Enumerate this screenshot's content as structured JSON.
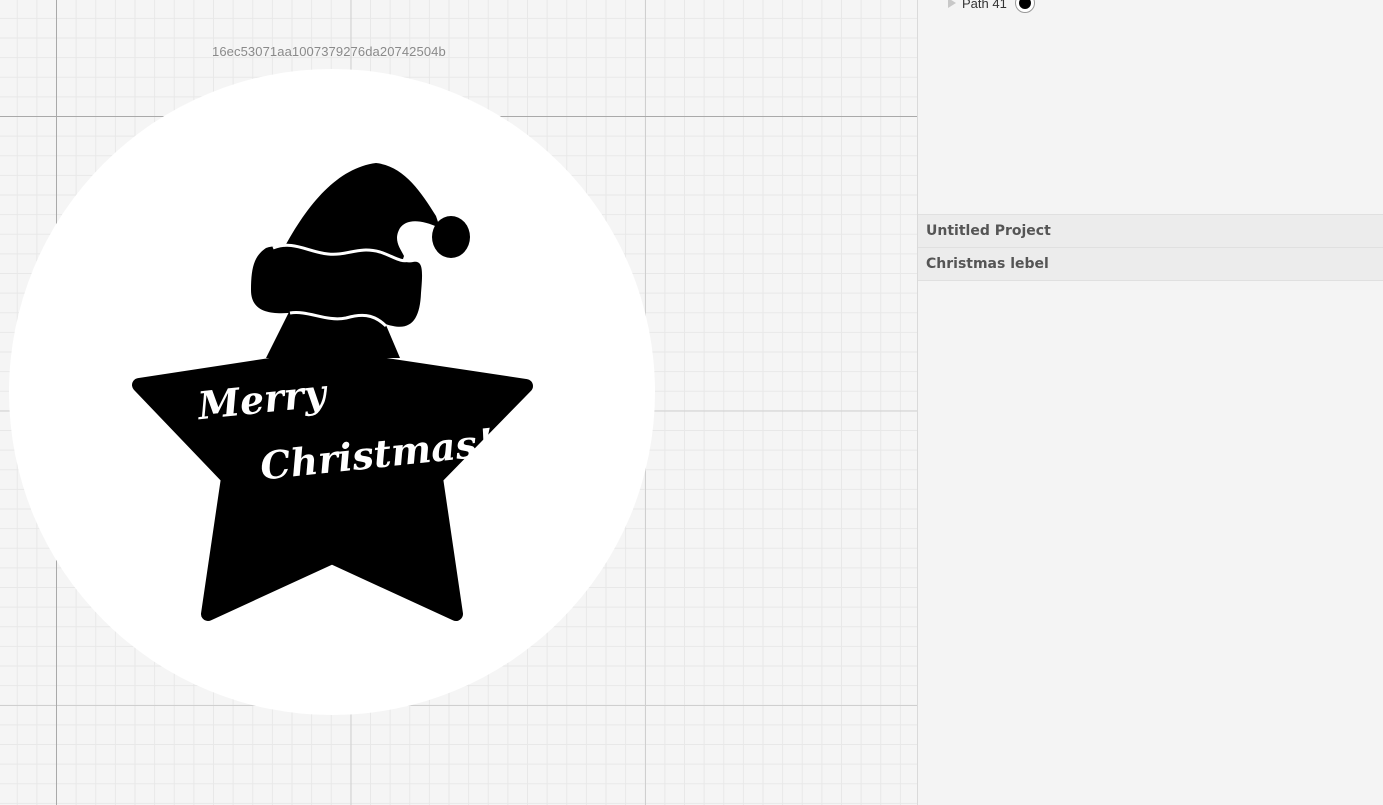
{
  "canvas": {
    "design_id": "16ec53071aa1007379276da20742504b",
    "artwork": {
      "line1": "Merry",
      "line2": "Christmas!",
      "fill_color": "#000000",
      "background_color": "#ffffff"
    }
  },
  "layers": {
    "items": [
      {
        "name": "Path 41",
        "color": "#000000",
        "icon": "expand-arrow-icon"
      }
    ]
  },
  "projects": {
    "items": [
      {
        "label": "Untitled Project"
      },
      {
        "label": "Christmas lebel"
      }
    ]
  }
}
